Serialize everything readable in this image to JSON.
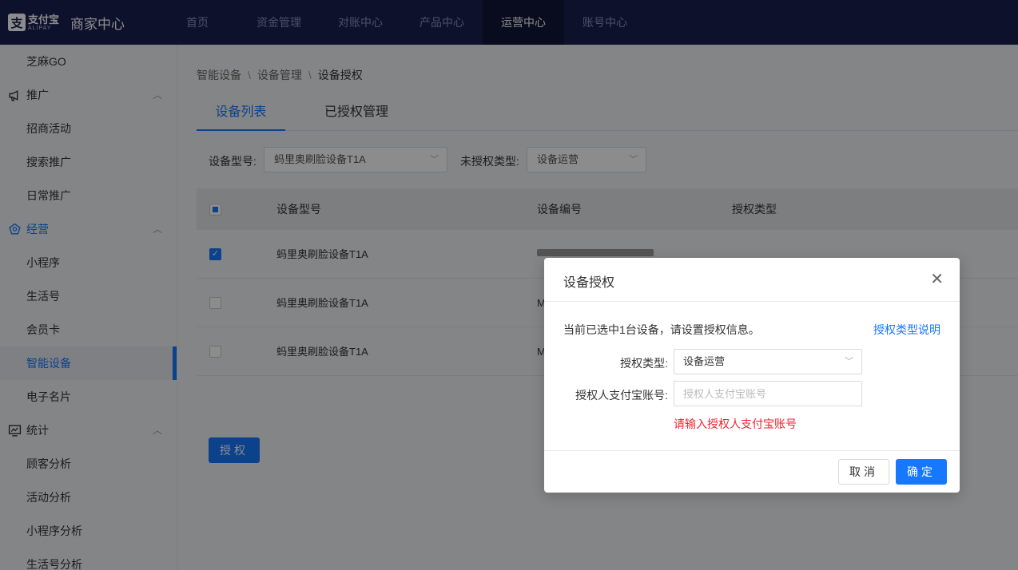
{
  "topbar": {
    "logo_cn": "支付宝",
    "logo_en": "ALIPAY",
    "title": "商家中心",
    "nav": [
      "首页",
      "资金管理",
      "对账中心",
      "产品中心",
      "运营中心",
      "账号中心"
    ]
  },
  "sidebar": {
    "items": [
      {
        "label": "芝麻GO"
      },
      {
        "label": "推广",
        "group": true
      },
      {
        "label": "招商活动"
      },
      {
        "label": "搜索推广"
      },
      {
        "label": "日常推广"
      },
      {
        "label": "经营",
        "group": true
      },
      {
        "label": "小程序"
      },
      {
        "label": "生活号"
      },
      {
        "label": "会员卡"
      },
      {
        "label": "智能设备"
      },
      {
        "label": "电子名片"
      },
      {
        "label": "统计",
        "group": true
      },
      {
        "label": "顾客分析"
      },
      {
        "label": "活动分析"
      },
      {
        "label": "小程序分析"
      },
      {
        "label": "生活号分析"
      }
    ]
  },
  "breadcrumb": [
    "智能设备",
    "设备管理",
    "设备授权"
  ],
  "breadcrumb_sep": "\\",
  "tabs": [
    "设备列表",
    "已授权管理"
  ],
  "filters": {
    "model_label": "设备型号:",
    "model_value": "蚂里奥刷脸设备T1A",
    "type_label": "未授权类型:",
    "type_value": "设备运营"
  },
  "table": {
    "headers": [
      "设备型号",
      "设备编号",
      "授权类型"
    ],
    "rows": [
      {
        "model": "蚂里奥刷脸设备T1A",
        "serial": "",
        "checked": true
      },
      {
        "model": "蚂里奥刷脸设备T1A",
        "serial": "M",
        "checked": false
      },
      {
        "model": "蚂里奥刷脸设备T1A",
        "serial": "M",
        "checked": false
      }
    ]
  },
  "auth_button": "授权",
  "modal": {
    "title": "设备授权",
    "info": "当前已选中1台设备，请设置授权信息。",
    "help_link": "授权类型说明",
    "type_label": "授权类型:",
    "type_value": "设备运营",
    "account_label": "授权人支付宝账号:",
    "account_placeholder": "授权人支付宝账号",
    "account_value": "",
    "error": "请输入授权人支付宝账号",
    "cancel": "取消",
    "ok": "确定"
  },
  "colors": {
    "primary": "#1677ff",
    "topbar": "#1a2050",
    "error": "#f5222d"
  }
}
